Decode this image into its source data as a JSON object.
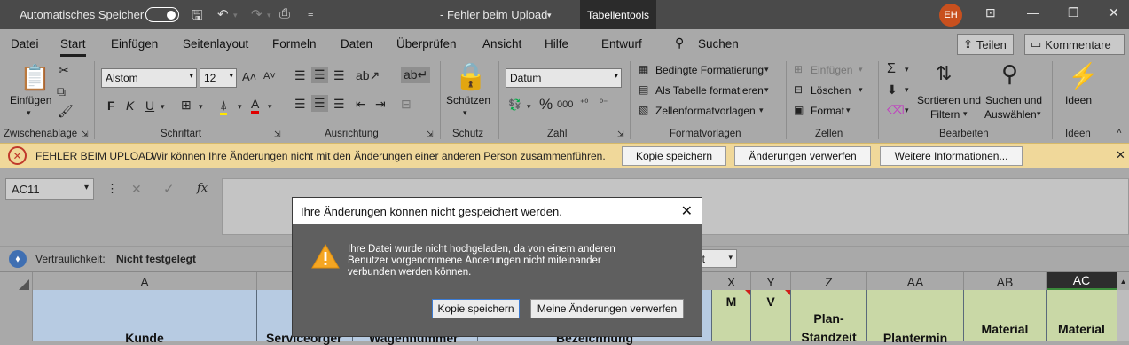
{
  "titlebar": {
    "autosave_label": "Automatisches Speichern",
    "doc_title": "- Fehler beim Upload",
    "context_tab": "Tabellentools",
    "avatar_initials": "EH"
  },
  "menu": {
    "tabs": [
      "Datei",
      "Start",
      "Einfügen",
      "Seitenlayout",
      "Formeln",
      "Daten",
      "Überprüfen",
      "Ansicht",
      "Hilfe",
      "Entwurf"
    ],
    "search": "Suchen",
    "share": "Teilen",
    "comments": "Kommentare"
  },
  "ribbon": {
    "clipboard": {
      "paste": "Einfügen",
      "label": "Zwischenablage"
    },
    "font": {
      "name": "Alstom",
      "size": "12",
      "label": "Schriftart"
    },
    "alignment": {
      "label": "Ausrichtung"
    },
    "protect": {
      "btn": "Schützen",
      "label": "Schutz"
    },
    "number": {
      "format": "Datum",
      "label": "Zahl"
    },
    "styles": {
      "cond": "Bedingte Formatierung",
      "table": "Als Tabelle formatieren",
      "cell": "Zellenformatvorlagen",
      "label": "Formatvorlagen"
    },
    "cells": {
      "insert": "Einfügen",
      "delete": "Löschen",
      "format": "Format",
      "label": "Zellen"
    },
    "edit": {
      "sort1": "Sortieren und",
      "sort2": "Filtern",
      "find1": "Suchen und",
      "find2": "Auswählen",
      "label": "Bearbeiten"
    },
    "ideas": {
      "btn": "Ideen",
      "label": "Ideen"
    }
  },
  "errorbar": {
    "title": "FEHLER BEIM UPLOAD",
    "message": "Wir können Ihre Änderungen nicht mit den Änderungen einer anderen Person zusammenführen.",
    "btn_save": "Kopie speichern",
    "btn_discard": "Änderungen verwerfen",
    "btn_more": "Weitere Informationen..."
  },
  "formula": {
    "namebox": "AC11",
    "fx": "fx"
  },
  "confidentiality": {
    "label": "Vertraulichkeit:",
    "value": "Nicht festgelegt",
    "filter_partial": "et"
  },
  "columns": [
    "A",
    "X",
    "Y",
    "Z",
    "AA",
    "AB",
    "AC"
  ],
  "cells": {
    "a": "Kunde",
    "b": "Serviceorger",
    "c": "Wagennummer",
    "d": "Bezeichnung",
    "x": "M",
    "y": "V",
    "z1": "Plan-",
    "z2": "Standzeit",
    "aa": "Plantermin",
    "ab": "Material",
    "ac": "Material"
  },
  "dialog": {
    "title": "Ihre Änderungen können nicht gespeichert werden.",
    "message": "Ihre Datei wurde nicht hochgeladen, da von einem anderen Benutzer vorgenommene Änderungen nicht miteinander verbunden werden können.",
    "btn_save": "Kopie speichern",
    "btn_discard": "Meine Änderungen verwerfen"
  },
  "colors": {
    "error_bar": "#f0d89a",
    "header_blue": "#b7cbe2",
    "header_green": "#c9d8a6",
    "titlebar": "#4a4a4a"
  }
}
